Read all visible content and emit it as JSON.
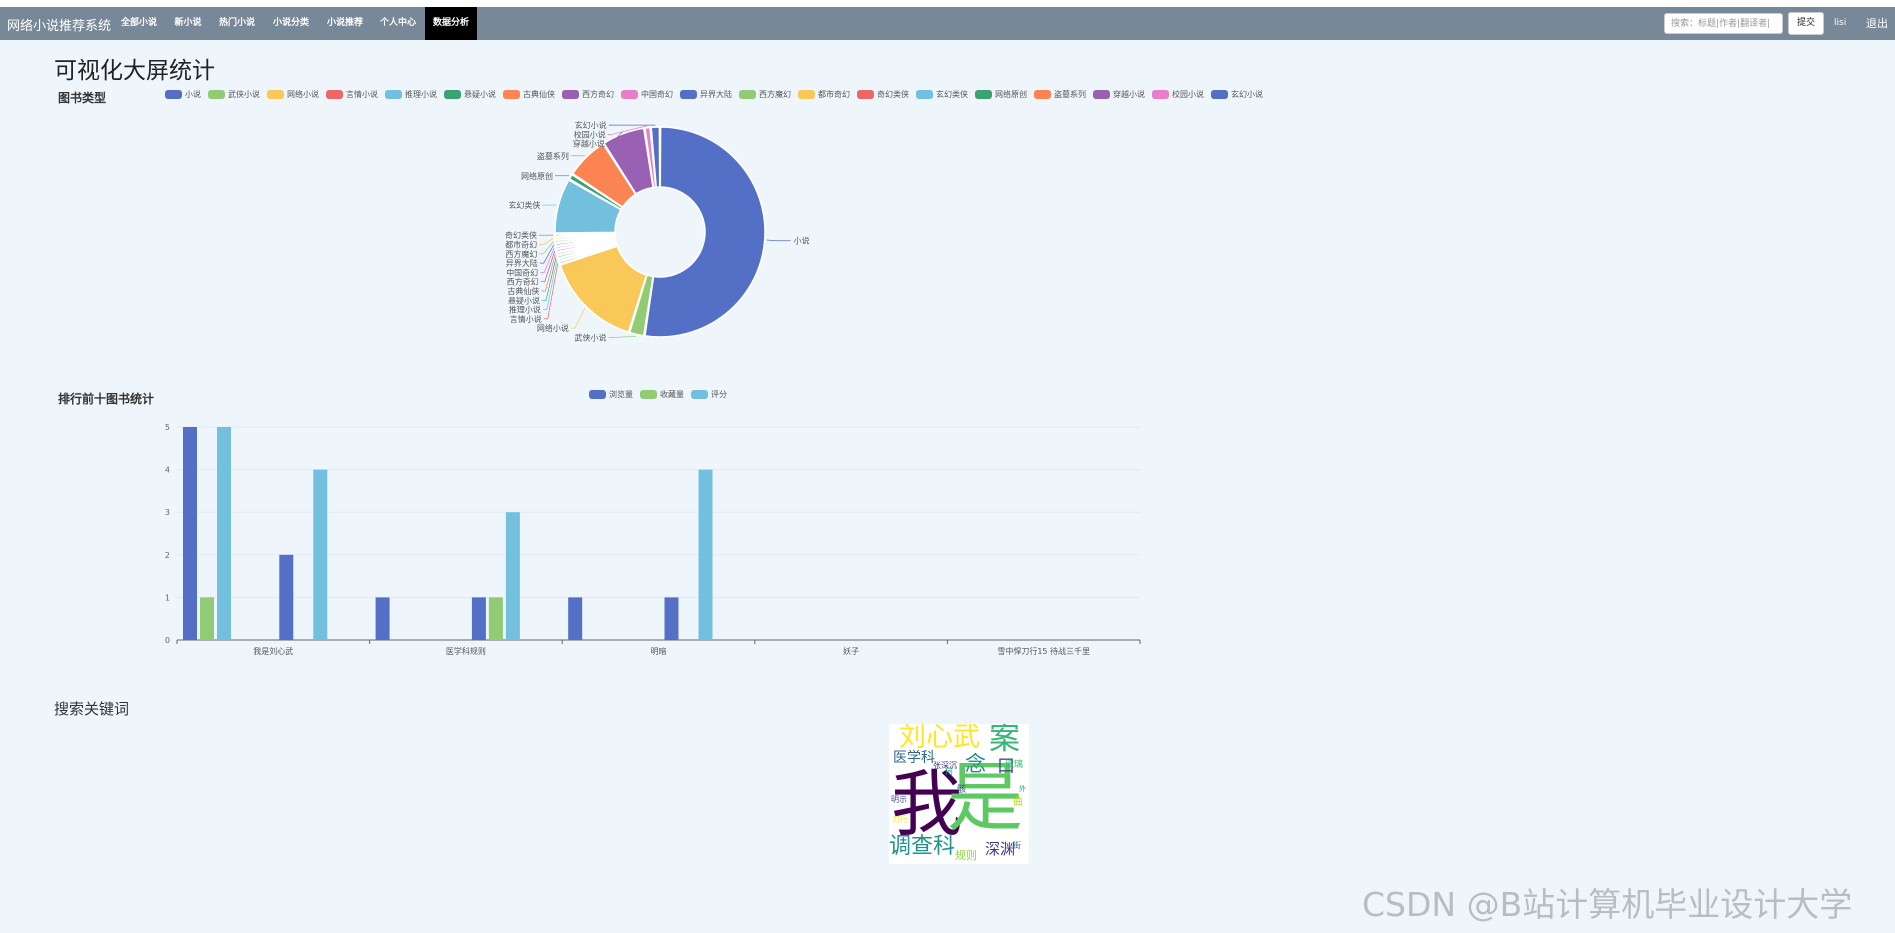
{
  "navbar": {
    "brand": "网络小说推荐系统",
    "items": [
      {
        "label": "全部小说"
      },
      {
        "label": "新小说"
      },
      {
        "label": "热门小说"
      },
      {
        "label": "小说分类"
      },
      {
        "label": "小说推荐"
      },
      {
        "label": "个人中心"
      },
      {
        "label": "数据分析"
      }
    ],
    "active_item": "数据分析",
    "search_placeholder": "搜索：标题|作者|翻译者|",
    "submit_label": "提交",
    "username": "lisi",
    "logout_label": "退出"
  },
  "page": {
    "title": "可视化大屏统计",
    "pie_title": "图书类型",
    "bar_title": "排行前十图书统计",
    "keyword_title": "搜索关键词",
    "watermark": "CSDN @B站计算机毕业设计大学"
  },
  "colors": {
    "navbar": "#778899",
    "background": "#eef6fc",
    "palette": [
      "#5470c6",
      "#91cc75",
      "#fac858",
      "#ee6666",
      "#73c0de",
      "#3ba272",
      "#fc8452",
      "#9a60b4",
      "#ea7ccc"
    ]
  },
  "chart_data": [
    {
      "type": "pie",
      "title": "图书类型",
      "donut": true,
      "legend_placement": "top",
      "legend": [
        "小说",
        "武侠小说",
        "网络小说",
        "言情小说",
        "推理小说",
        "悬疑小说",
        "古典仙侠",
        "西方奇幻",
        "中国奇幻",
        "异界大陆",
        "西方魔幻",
        "都市奇幻",
        "奇幻类侠",
        "玄幻类侠",
        "网络原创",
        "盗墓系列",
        "穿越小说",
        "校园小说",
        "玄幻小说"
      ],
      "slices": [
        {
          "label": "小说",
          "value": 55
        },
        {
          "label": "武侠小说",
          "value": 2.5
        },
        {
          "label": "网络小说",
          "value": 16
        },
        {
          "label": "言情小说",
          "value": 0.5
        },
        {
          "label": "推理小说",
          "value": 0.5
        },
        {
          "label": "悬疑小说",
          "value": 0.5
        },
        {
          "label": "古典仙侠",
          "value": 0.5
        },
        {
          "label": "西方奇幻",
          "value": 0.5
        },
        {
          "label": "中国奇幻",
          "value": 0.5
        },
        {
          "label": "异界大陆",
          "value": 0.5
        },
        {
          "label": "西方魔幻",
          "value": 0.5
        },
        {
          "label": "都市奇幻",
          "value": 0.5
        },
        {
          "label": "奇幻类侠",
          "value": 0.5
        },
        {
          "label": "玄幻类侠",
          "value": 9
        },
        {
          "label": "网络原创",
          "value": 1
        },
        {
          "label": "盗墓系列",
          "value": 7
        },
        {
          "label": "穿越小说",
          "value": 7
        },
        {
          "label": "校园小说",
          "value": 1
        },
        {
          "label": "玄幻小说",
          "value": 1.5
        }
      ]
    },
    {
      "type": "bar",
      "title": "排行前十图书统计",
      "legend_placement": "top",
      "categories": [
        "我是刘心武",
        "医学科规则",
        "明暗",
        "妖子",
        "雪中悍刀行15 待战三千里"
      ],
      "series": [
        {
          "name": "浏览量",
          "values": [
            5,
            2,
            1,
            1,
            1,
            1,
            0,
            0,
            0,
            0
          ]
        },
        {
          "name": "收藏量",
          "values": [
            1,
            0,
            0,
            1,
            0,
            0,
            0,
            0,
            0,
            0
          ]
        },
        {
          "name": "评分",
          "values": [
            5,
            4,
            0,
            3,
            0,
            4,
            0,
            0,
            0,
            0
          ]
        }
      ],
      "ylim": [
        0,
        5
      ],
      "yticks": [
        0,
        1,
        2,
        3,
        4,
        5
      ],
      "grid": true
    }
  ],
  "wordcloud": {
    "words": [
      {
        "text": "我",
        "color": "#440154"
      },
      {
        "text": "是",
        "color": "#5ec962"
      },
      {
        "text": "刘心武",
        "color": "#fde725"
      },
      {
        "text": "案",
        "color": "#35b779"
      },
      {
        "text": "调查科",
        "color": "#21918c"
      },
      {
        "text": "念",
        "color": "#21918c"
      },
      {
        "text": "口",
        "color": "#3b528b"
      },
      {
        "text": "医学科",
        "color": "#31688e"
      },
      {
        "text": "深渊",
        "color": "#443983"
      },
      {
        "text": "规则",
        "color": "#90d743"
      },
      {
        "text": "玻璃",
        "color": "#35b779"
      },
      {
        "text": "何",
        "color": "#21918c"
      },
      {
        "text": "骸",
        "color": "#3b528b"
      },
      {
        "text": "曲",
        "color": "#b5de2b"
      },
      {
        "text": "刀行",
        "color": "#fde725"
      },
      {
        "text": "明示",
        "color": "#3b528b"
      },
      {
        "text": "张深沉",
        "color": "#443983"
      },
      {
        "text": "外",
        "color": "#20a486"
      },
      {
        "text": "街",
        "color": "#31688e"
      }
    ]
  }
}
